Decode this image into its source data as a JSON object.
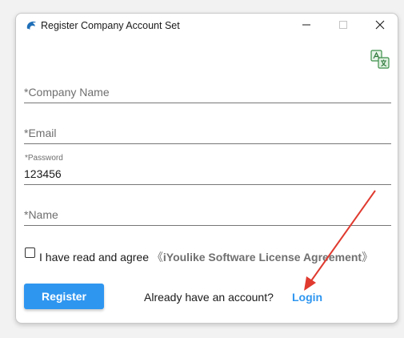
{
  "window": {
    "title": "Register Company Account Set"
  },
  "form": {
    "company_name_placeholder": "*Company Name",
    "email_placeholder": "*Email",
    "password_label": "*Password",
    "password_value": "123456",
    "name_placeholder": "*Name",
    "agree_prefix": "I have read and agree",
    "agree_open_bracket": "《",
    "agree_link": "iYoulike Software License Agreement",
    "agree_close_bracket": "》",
    "agree_checked": false
  },
  "footer": {
    "register_label": "Register",
    "already_text": "Already have an account?",
    "login_label": "Login"
  },
  "icons": {
    "app": "dolphin-icon",
    "corner": "translate-logo-icon",
    "minimize": "minimize-icon",
    "maximize": "maximize-icon",
    "close": "close-icon"
  },
  "colors": {
    "accent": "#2f96f0",
    "annotation_arrow": "#e03a2f"
  }
}
